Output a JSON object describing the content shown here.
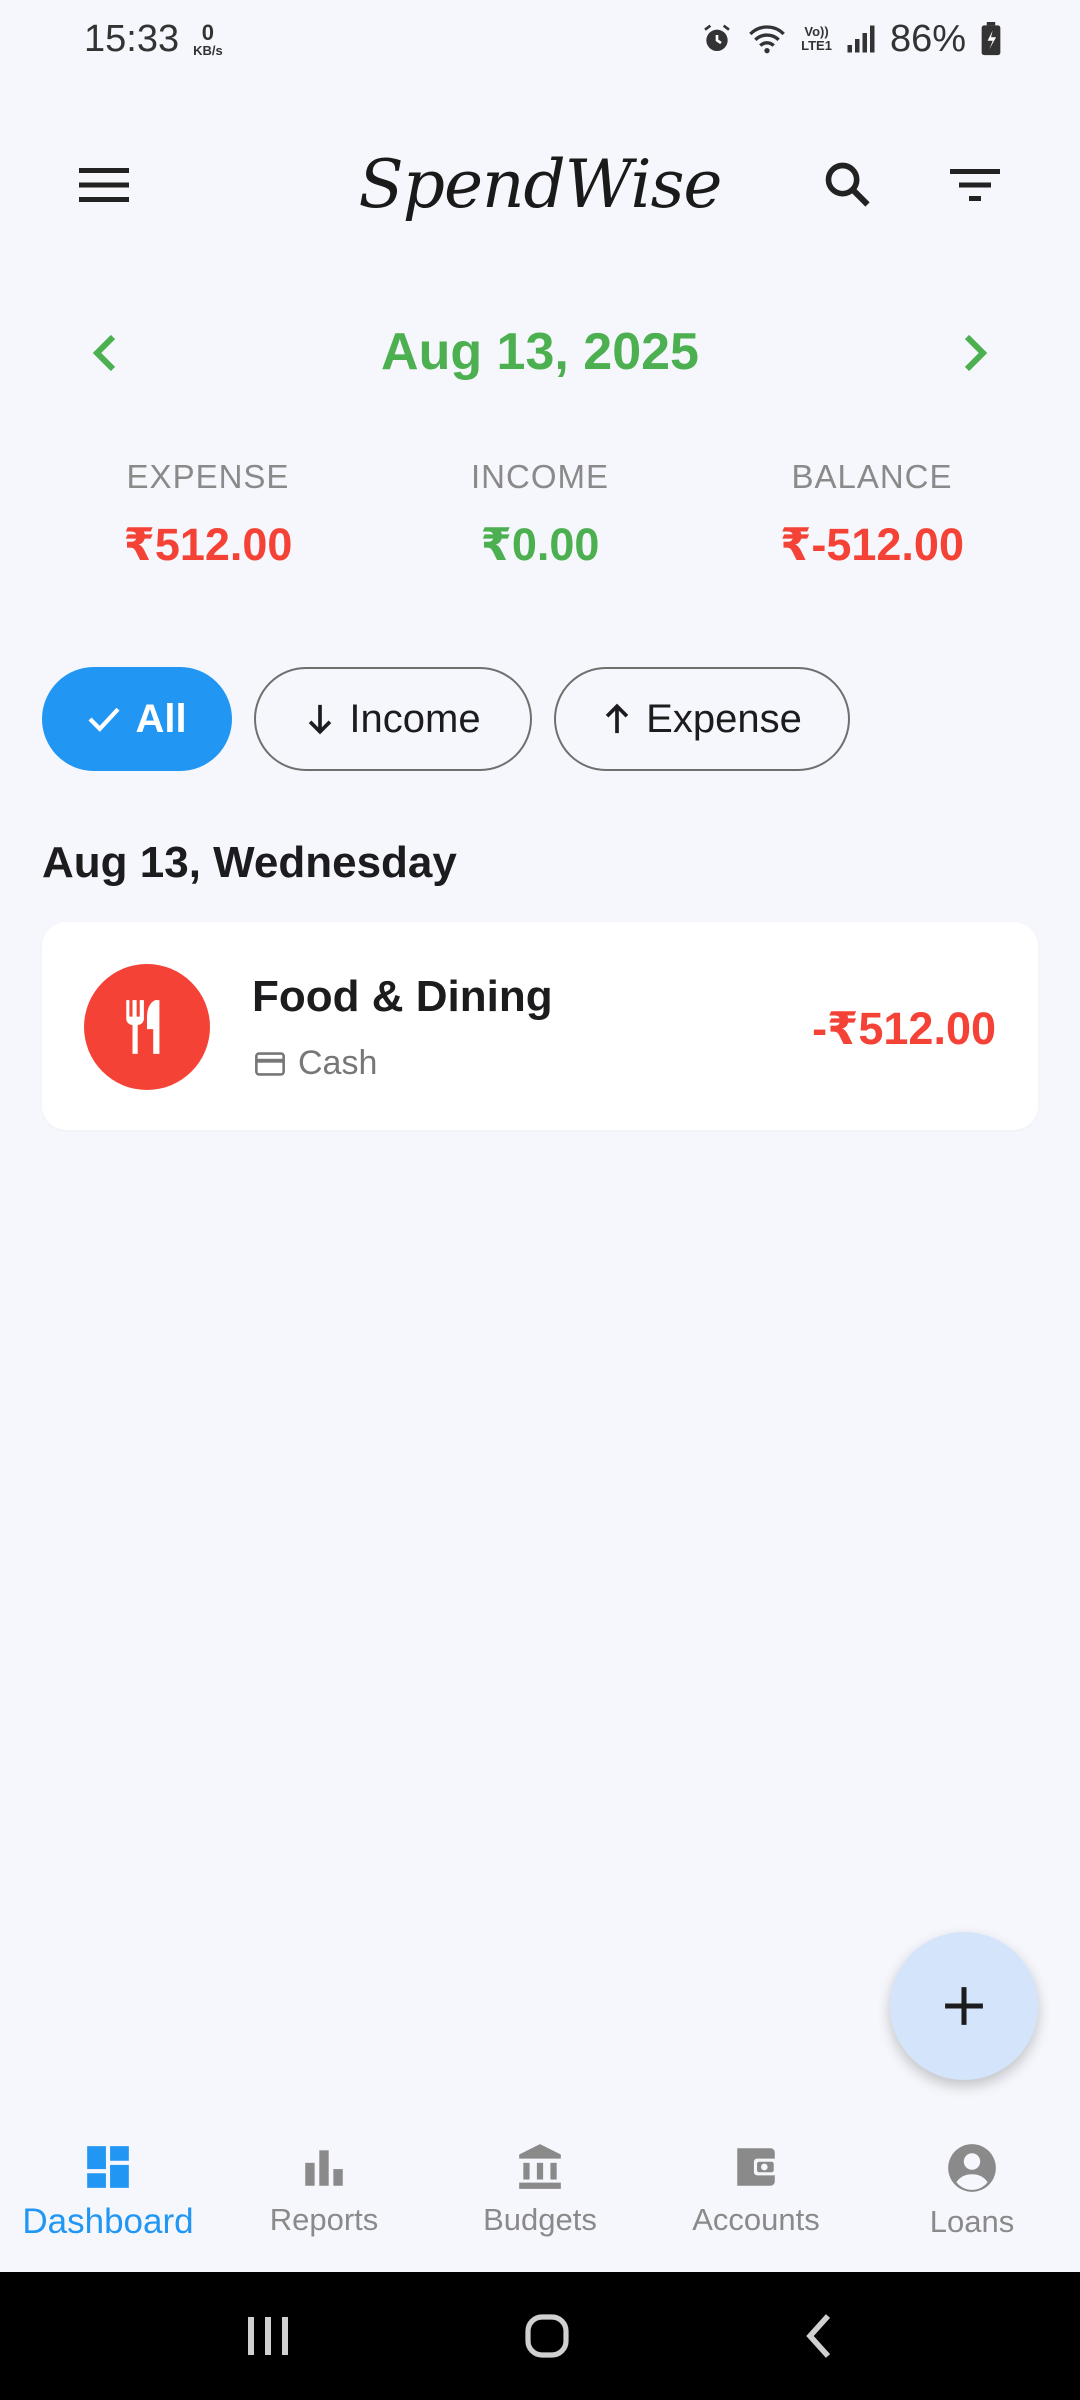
{
  "status_bar": {
    "time": "15:33",
    "net_speed_value": "0",
    "net_speed_unit": "KB/s",
    "volte_line1": "Vo))",
    "volte_line2": "LTE1",
    "battery": "86%"
  },
  "app_bar": {
    "title": "SpendWise",
    "menu_icon": "menu-icon",
    "search_icon": "search-icon",
    "filter_icon": "filter-icon"
  },
  "date_nav": {
    "date": "Aug 13, 2025"
  },
  "summary": {
    "expense_label": "EXPENSE",
    "expense_value": "₹512.00",
    "income_label": "INCOME",
    "income_value": "₹0.00",
    "balance_label": "BALANCE",
    "balance_value": "₹-512.00"
  },
  "filters": [
    {
      "label": "All",
      "active": true
    },
    {
      "label": "Income",
      "active": false
    },
    {
      "label": "Expense",
      "active": false
    }
  ],
  "section_date": "Aug 13, Wednesday",
  "transactions": [
    {
      "category": "Food & Dining",
      "account": "Cash",
      "amount": "-₹512.00",
      "icon": "restaurant-icon"
    }
  ],
  "bottom_nav": [
    {
      "label": "Dashboard",
      "icon": "dashboard-icon",
      "active": true
    },
    {
      "label": "Reports",
      "icon": "bar-chart-icon",
      "active": false
    },
    {
      "label": "Budgets",
      "icon": "bank-icon",
      "active": false
    },
    {
      "label": "Accounts",
      "icon": "wallet-icon",
      "active": false
    },
    {
      "label": "Loans",
      "icon": "account-circle-icon",
      "active": false
    }
  ],
  "colors": {
    "expense": "#f44336",
    "income": "#4caf50",
    "accent": "#2196f3",
    "fab": "#d4e4fb"
  }
}
